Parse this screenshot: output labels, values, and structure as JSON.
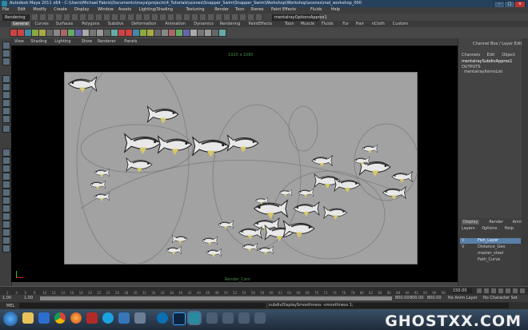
{
  "window": {
    "title": "Autodesk Maya 2011 x64 - C:\\Users\\Michael Fabris\\Documents\\maya\\projects\\4_Tutorials\\scenes\\Snapper_Swim\\Snapper_Swim\\Workshop\\Workshop\\scenes\\mel_workshop_0005.mb*",
    "mel_selection": "mentalrayOptionsApprox1"
  },
  "menubar": [
    "File",
    "Edit",
    "Modify",
    "Create",
    "Display",
    "Window",
    "Assets",
    "Lighting/Shading",
    "Texturing",
    "Render",
    "Toon",
    "Stereo",
    "Paint Effects",
    "Fluids",
    "Help"
  ],
  "statusline": {
    "mode": "Rendering"
  },
  "shelf_tabs": [
    "General",
    "Curves",
    "Surfaces",
    "Polygons",
    "Subdivs",
    "Deformation",
    "Animation",
    "Dynamics",
    "Rendering",
    "PaintEffects",
    "Toon",
    "Muscle",
    "Fluids",
    "Fur",
    "Hair",
    "nCloth",
    "Custom"
  ],
  "panel_menu": [
    "View",
    "Shading",
    "Lighting",
    "Show",
    "Renderer",
    "Panels"
  ],
  "viewport": {
    "resolution_label": "1920 x 1080",
    "camera_label": "Render_Cam"
  },
  "channel_box": {
    "header": "Channel Box / Layer Editor",
    "menu": [
      "Channels",
      "Edit",
      "Object",
      "Show"
    ],
    "node_name": "mentalraySubdivApprox1",
    "outputs_label": "OUTPUTS",
    "output_item": "mentalrayItemsList"
  },
  "layer_editor": {
    "tabs": [
      "Display",
      "Render",
      "Anim"
    ],
    "menu": [
      "Layers",
      "Options",
      "Help"
    ],
    "layers": [
      {
        "flag": "V",
        "name": "Fish_Layer"
      },
      {
        "flag": "V",
        "name": "Distance_Geo"
      },
      {
        "flag": "",
        "name": "master_steel"
      },
      {
        "flag": "",
        "name": "Path_Curve"
      }
    ]
  },
  "time_slider": {
    "ticks": [
      "2",
      "4",
      "6",
      "8",
      "10",
      "12",
      "14",
      "16",
      "18",
      "20",
      "22",
      "24",
      "26",
      "28",
      "30",
      "32",
      "34",
      "36",
      "38",
      "40",
      "42",
      "44",
      "46",
      "48",
      "50",
      "52",
      "54",
      "56",
      "58",
      "60",
      "62",
      "64",
      "66",
      "68",
      "70",
      "72",
      "74",
      "76",
      "78",
      "80",
      "82",
      "84",
      "86",
      "88",
      "90",
      "92",
      "94",
      "96",
      "98"
    ],
    "current_frame": "150.00"
  },
  "range_slider": {
    "start": "1.00",
    "inner_start": "1.00",
    "inner_end": "800.00",
    "end": "800.00",
    "end2": "800.00",
    "anim_layer": "No Anim Layer",
    "character_set": "No Character Set"
  },
  "command_line": {
    "label": "MEL",
    "feedback": "subdivDisplaySmoothness -smoothness 1;"
  },
  "taskbar": {
    "watermark": "GHOSTXX.COM"
  },
  "colors": {
    "maya_bg": "#444444",
    "viewport_bg": "#000000",
    "render_gate": "#a2a2a2",
    "selected_layer": "#5a7fa8",
    "taskbar": "#2a3b4f"
  }
}
